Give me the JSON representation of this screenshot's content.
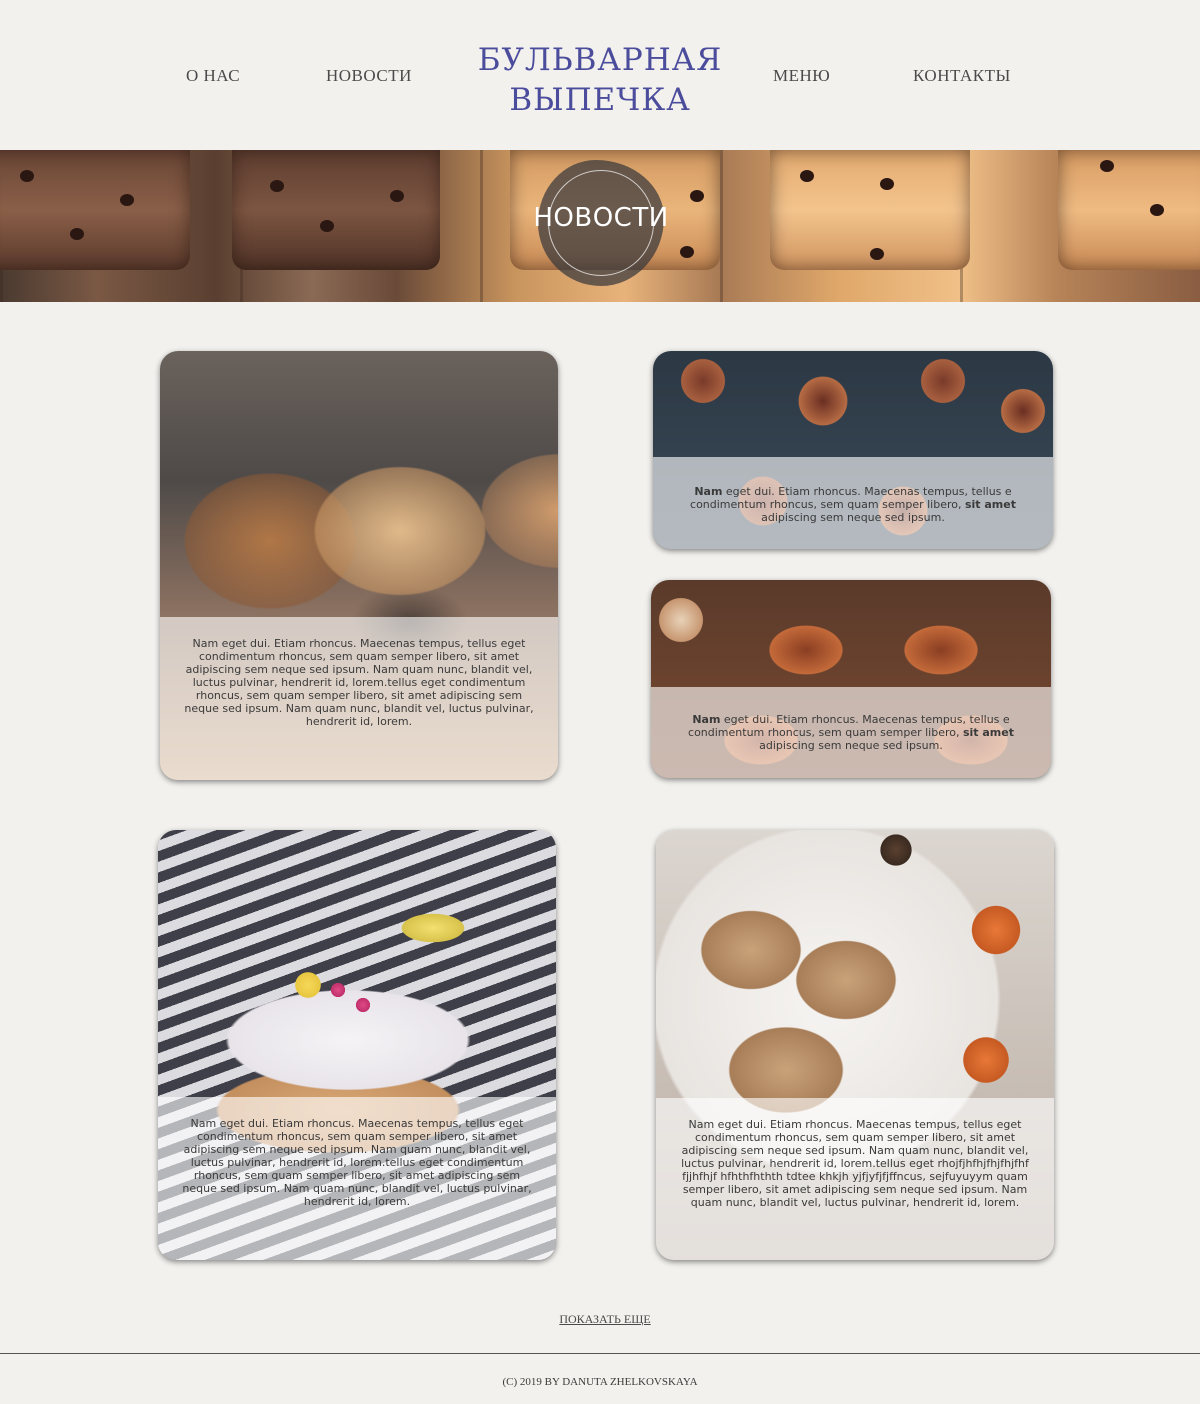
{
  "nav": {
    "about": "О НАС",
    "news": "НОВОСТИ",
    "menu": "МЕНЮ",
    "contacts": "КОНТАКТЫ"
  },
  "logo": {
    "line1": "БУЛЬВАРНАЯ",
    "line2": "ВЫПЕЧКА"
  },
  "hero": {
    "title": "НОВОСТИ"
  },
  "cards": [
    {
      "photo": "seeded-bread-loaves",
      "text": "Nam eget dui. Etiam rhoncus. Maecenas tempus, tellus eget condimentum rhoncus, sem quam semper libero, sit amet adipiscing sem neque sed ipsum. Nam quam nunc, blandit vel, luctus pulvinar, hendrerit id, lorem.tellus eget condimentum rhoncus, sem quam semper libero, sit amet adipiscing sem neque sed ipsum. Nam quam nunc, blandit vel, luctus pulvinar, hendrerit id, lorem."
    },
    {
      "photo": "cinnamon-rolls",
      "bold_start": "Nam",
      "text": " eget dui. Etiam rhoncus. Maecenas tempus, tellus e condimentum rhoncus, sem quam semper libero, ",
      "bold_end": "sit amet",
      "text_end": " adipiscing sem neque sed ipsum."
    },
    {
      "photo": "cinnamon-buns-on-board",
      "bold_start": "Nam",
      "text": " eget dui. Etiam rhoncus. Maecenas tempus, tellus e condimentum rhoncus, sem quam semper libero, ",
      "bold_end": "sit amet",
      "text_end": " adipiscing sem neque sed ipsum."
    },
    {
      "photo": "lemon-glazed-loaf-cake",
      "text": "Nam eget dui. Etiam rhoncus. Maecenas tempus, tellus eget condimentum rhoncus, sem quam semper libero, sit amet adipiscing sem neque sed ipsum. Nam quam nunc, blandit vel, luctus pulvinar, hendrerit id, lorem.tellus eget condimentum rhoncus, sem quam semper libero, sit amet adipiscing sem neque sed ipsum. Nam quam nunc, blandit vel, luctus pulvinar, hendrerit id, lorem."
    },
    {
      "photo": "glazed-scones-with-pumpkins",
      "text": "Nam eget dui. Etiam rhoncus. Maecenas tempus, tellus eget condimentum rhoncus, sem quam semper libero, sit amet adipiscing sem neque sed ipsum. Nam quam nunc, blandit vel, luctus pulvinar, hendrerit id, lorem.tellus eget rhojfjhfhjfhjfhjfhf  fjjhfhjf  hfhthfhthth tdtee khkjh yjfjyfjfjffncus, sejfuyuyym quam semper libero, sit amet adipiscing sem neque sed ipsum. Nam quam nunc, blandit vel, luctus pulvinar, hendrerit id, lorem."
    }
  ],
  "show_more": "ПОКАЗАТЬ ЕЩЕ",
  "footer": "(C) 2019  BY DANUTA ZHELKOVSKAYA",
  "colors": {
    "logo": "#4b4d9c",
    "background": "#f2f1ee",
    "text": "#4a4a4a"
  }
}
